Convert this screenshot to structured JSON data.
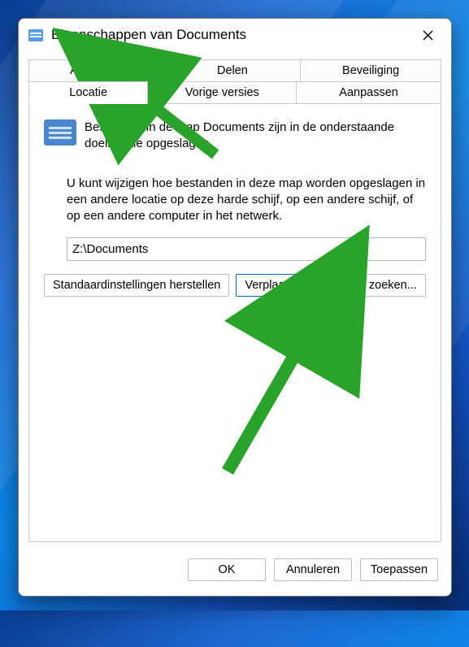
{
  "window": {
    "title": "Eigenschappen van Documents"
  },
  "tabs": {
    "algemeen": "Algemeen",
    "delen": "Delen",
    "beveiliging": "Beveiliging",
    "locatie": "Locatie",
    "vorige_versies": "Vorige versies",
    "aanpassen": "Aanpassen"
  },
  "content": {
    "desc1": "Bestanden in de map Documents zijn in de onderstaande doellocatie opgeslagen.",
    "desc2": "U kunt wijzigen hoe bestanden in deze map worden opgeslagen in een andere locatie op deze harde schijf, op een andere schijf, of op een andere computer in het netwerk.",
    "path_value": "Z:\\Documents",
    "restore_defaults": "Standaardinstellingen herstellen",
    "move": "Verplaatsen...",
    "find_target": "Doel zoeken..."
  },
  "footer": {
    "ok": "OK",
    "cancel": "Annuleren",
    "apply": "Toepassen"
  }
}
